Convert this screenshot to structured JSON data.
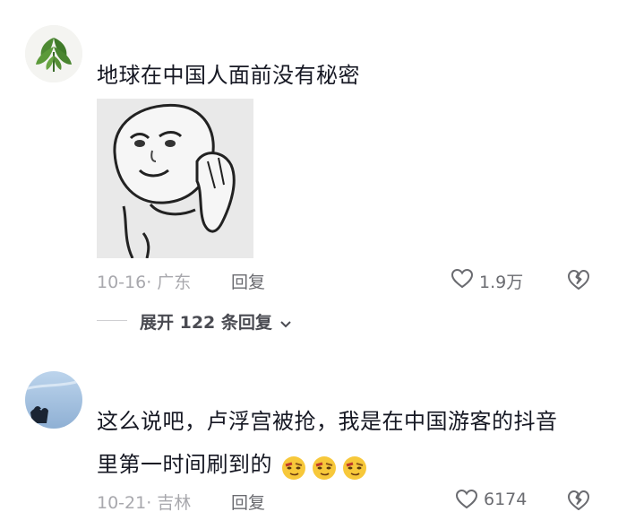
{
  "comments": [
    {
      "text": "地球在中国人面前没有秘密",
      "meta": "10-16· 广东",
      "reply_label": "回复",
      "likes": "1.9万",
      "has_sticker": true
    },
    {
      "text_line1": "这么说吧，卢浮宫被抢，我是在中国游客的抖音",
      "text_line2": "里第一时间刷到的",
      "meta": "10-21· 吉林",
      "reply_label": "回复",
      "likes": "6174",
      "emoji_count": 3
    }
  ],
  "expand_replies": "展开 122 条回复",
  "icons": {
    "like": "heart-outline-icon",
    "dislike": "broken-heart-icon",
    "expand": "chevron-down-icon"
  },
  "colors": {
    "text": "#161823",
    "meta": "#a8a8ad",
    "action": "#6a6b70"
  }
}
